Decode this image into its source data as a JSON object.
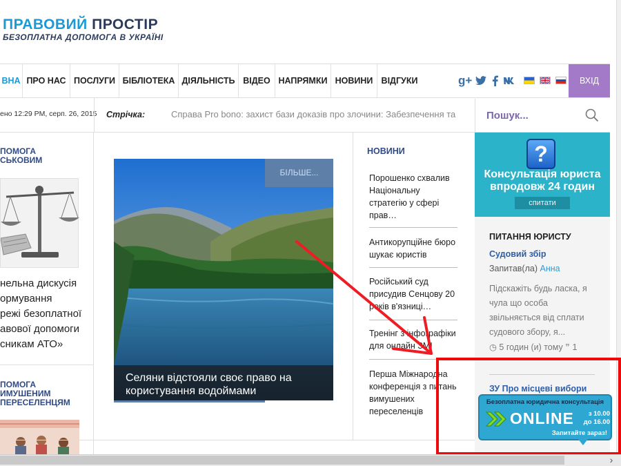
{
  "logo": {
    "part1": "ПРАВОВИЙ",
    "part2": "ПРОСТІР",
    "subtitle": "БЕЗОПЛАТНА ДОПОМОГА В УКРАЇНІ"
  },
  "nav": {
    "items": [
      "ВНА",
      "ПРО НАС",
      "ПОСЛУГИ",
      "БІБЛІОТЕКА",
      "ДІЯЛЬНІСТЬ",
      "ВІДЕО",
      "НАПРЯМКИ",
      "НОВИНИ",
      "ВІДГУКИ"
    ],
    "social": [
      "g+",
      "t",
      "f",
      "vk"
    ],
    "login": "ВХІД"
  },
  "strip": {
    "date": "ено 12:29 PM, серп. 26, 2015",
    "ticker_label": "Стрічка:",
    "ticker_text": "Справа Pro bono: захист бази доказів про злочини: Забезпечення та",
    "search_placeholder": "Пошук..."
  },
  "left": {
    "cat1": "ПОМОГА\nСЬКОВИМ",
    "article": "нельна дискусія\nормування\nрежі безоплатної\nавової допомоги\nсникам АТО»",
    "cat2": "ПОМОГА\nИМУШЕНИМ\nПЕРЕСЕЛЕНЦЯМ"
  },
  "featured": {
    "more": "БІЛЬШЕ...",
    "caption": "Селяни відстояли своє право на користування водоймами"
  },
  "news": {
    "heading": "НОВИНИ",
    "items": [
      "Порошенко схвалив Національну стратегію у сфері прав…",
      "Антикорупційне бюро шукає юристів",
      "Російський суд присудив Сенцову 20 років в'язниці…",
      "Тренінг з інфографіки для онлайн ЗМІ",
      "Перша Міжнародна конференція з питань вимушених переселенців"
    ]
  },
  "right": {
    "consult_text": "Консультація юриста впродовж 24 годин",
    "consult_btn": "спитати",
    "heading": "ПИТАННЯ ЮРИСТУ",
    "q1_title": "Судовий збір",
    "q1_asked": "Запитав(ла)",
    "q1_author": "Анна",
    "q1_body": "Підскажіть будь ласка, я чула що особа звільняється від сплати судового збору, я...",
    "q1_time": "5 годин (и) тому",
    "q1_count": "1",
    "q2_title": "ЗУ Про місцеві вибори"
  },
  "online": {
    "top": "Безоплатна юридична консультація",
    "word": "ONLINE",
    "time1": "з 10.00",
    "time2": "до 16.00",
    "ask": "Запитайте зараз!"
  },
  "colors": {
    "brand_blue": "#1a9ad6",
    "navy": "#2f4a86",
    "login_purple": "#a37ac7",
    "consult_teal": "#2bb3c9",
    "highlight_red": "#ee0a0a"
  }
}
